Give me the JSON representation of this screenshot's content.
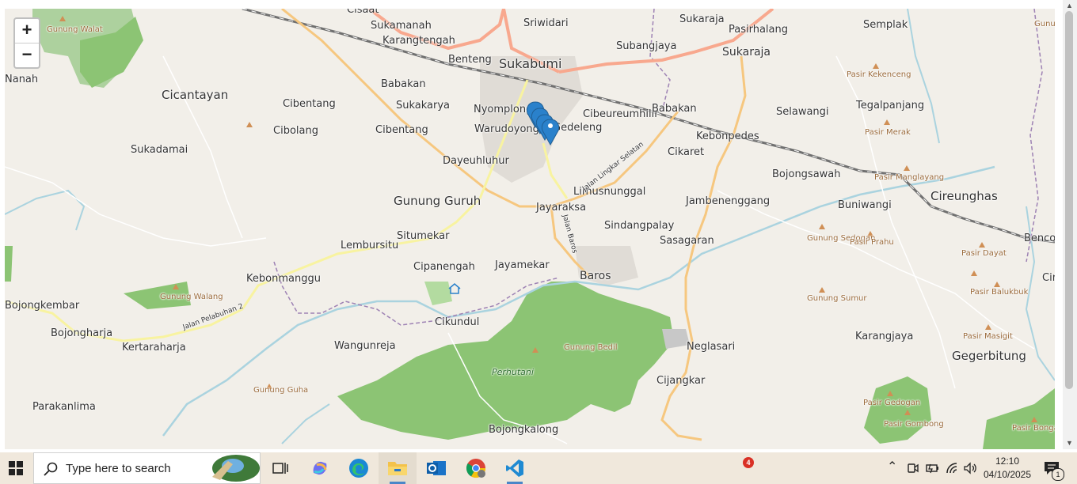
{
  "map": {
    "zoom_in_label": "+",
    "zoom_out_label": "−",
    "forest_label": "Perhutani",
    "colors": {
      "land": "#f2efe9",
      "forest": "#8cc474",
      "river": "#aad3df",
      "primary_road": "#f8a88e",
      "secondary_road": "#f6c77f",
      "tertiary_road": "#f8f3a0",
      "marker": "#2a81cb"
    },
    "cities": [
      "Sukabumi",
      "Gunung Guruh",
      "Cicantayan",
      "Cireunghas",
      "Gegerbitung",
      "Sukaraja"
    ],
    "towns": [
      "Baros",
      "Jayaraksa",
      "Limusnunggal",
      "Sindangpalay",
      "Jambenenggang",
      "Kebonpedes",
      "Bojongsawah",
      "Selawangi",
      "Tegalpanjang",
      "Semplak",
      "Pasirhalang",
      "Sukaraja",
      "Subangjaya",
      "Sriwidari",
      "Sukamanah",
      "Karangtengah",
      "Benteng",
      "Babakan",
      "Sukakarya",
      "Cibentang",
      "Cibolang",
      "Sukadamai",
      "Nyomplong",
      "Warudoyong",
      "Gedeleng",
      "Cibeureumhilir",
      "Cikaret",
      "Dayeuhluhur",
      "Situmekar",
      "Lembursitu",
      "Cipanengah",
      "Jayamekar",
      "Kebonmanggu",
      "Cikundul",
      "Wangunreja",
      "Kertaraharja",
      "Bojongharja",
      "Bojongkembar",
      "Parakanlima",
      "Bojongkalong",
      "Cijangkar",
      "Neglasari",
      "Sasagaran",
      "Buniwangi",
      "Karangjaya",
      "Bencoy",
      "Cisaat",
      "Nanah",
      "Cin"
    ],
    "peaks": [
      "Gunung Walat",
      "Gunung Walang",
      "Gunung Guha",
      "Gunung Bedil",
      "Gunung Sedogan",
      "Gunung Sumur",
      "Pasir Kekenceng",
      "Pasir Merak",
      "Pasir Manglayang",
      "Pasir Prahu",
      "Pasir Dayat",
      "Pasir Balukbuk",
      "Pasir Masigit",
      "Pasir Gedogan",
      "Pasir Gombong",
      "Pasir Bonga",
      "Gunung M"
    ],
    "roads": [
      "Jalan Lingkar Selatan",
      "Jalan Baros",
      "Jalan Pelabuhan 2"
    ],
    "marker_count": 4
  },
  "taskbar": {
    "search_placeholder": "Type here to search",
    "time": "12:10",
    "date": "04/10/2025",
    "notification_badge": "4",
    "notification_count": "1"
  }
}
